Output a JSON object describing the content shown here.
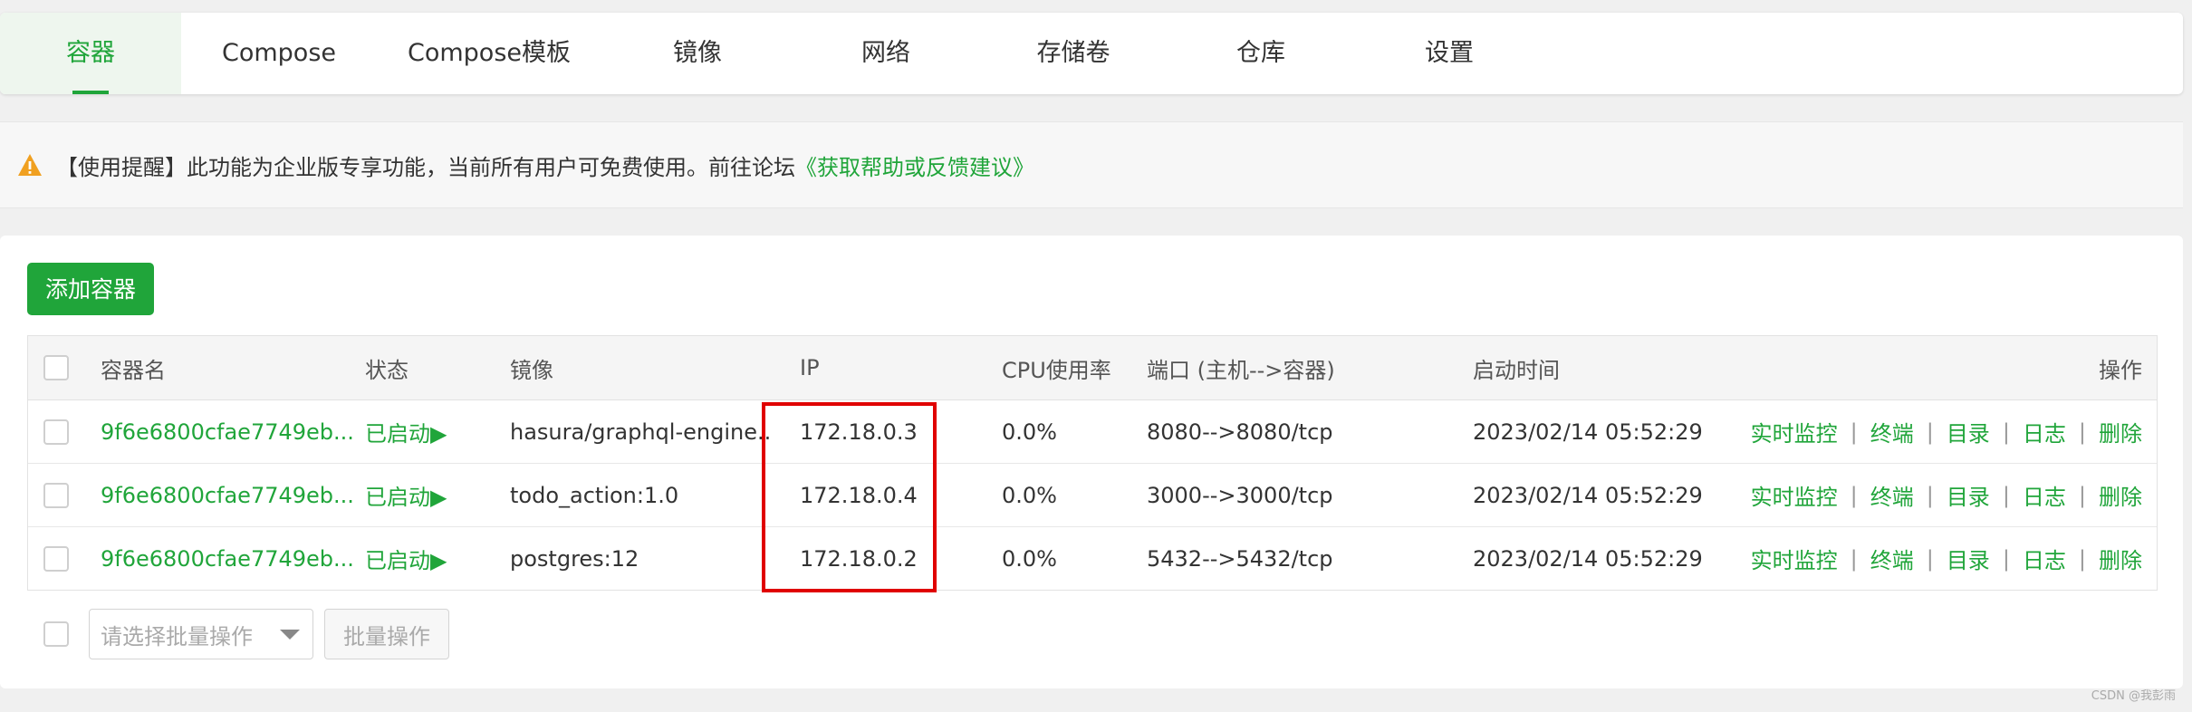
{
  "tabs": [
    {
      "label": "容器",
      "active": true
    },
    {
      "label": "Compose"
    },
    {
      "label": "Compose模板"
    },
    {
      "label": "镜像"
    },
    {
      "label": "网络"
    },
    {
      "label": "存储卷"
    },
    {
      "label": "仓库"
    },
    {
      "label": "设置"
    }
  ],
  "notice": {
    "icon": "warning-icon",
    "text": "【使用提醒】此功能为企业版专享功能，当前所有用户可免费使用。前往论坛",
    "link": "《获取帮助或反馈建议》"
  },
  "toolbar": {
    "add_label": "添加容器"
  },
  "table": {
    "headers": {
      "name": "容器名",
      "status": "状态",
      "image": "镜像",
      "ip": "IP",
      "cpu": "CPU使用率",
      "ports": "端口 (主机-->容器)",
      "started": "启动时间",
      "ops": "操作"
    },
    "rows": [
      {
        "name": "9f6e6800cfae7749eb...",
        "status": "已启动▶",
        "image": "hasura/graphql-engine...",
        "ip": "172.18.0.3",
        "cpu": "0.0%",
        "ports": "8080-->8080/tcp",
        "started": "2023/02/14 05:52:29"
      },
      {
        "name": "9f6e6800cfae7749eb...",
        "status": "已启动▶",
        "image": "todo_action:1.0",
        "ip": "172.18.0.4",
        "cpu": "0.0%",
        "ports": "3000-->3000/tcp",
        "started": "2023/02/14 05:52:29"
      },
      {
        "name": "9f6e6800cfae7749eb...",
        "status": "已启动▶",
        "image": "postgres:12",
        "ip": "172.18.0.2",
        "cpu": "0.0%",
        "ports": "5432-->5432/tcp",
        "started": "2023/02/14 05:52:29"
      }
    ],
    "ops": [
      "实时监控",
      "终端",
      "目录",
      "日志",
      "删除"
    ],
    "op_separator": "|"
  },
  "batch": {
    "select_placeholder": "请选择批量操作",
    "button_label": "批量操作"
  },
  "watermark": "CSDN @我彭雨",
  "colors": {
    "accent": "#20a53a",
    "highlight": "#e00000",
    "warning": "#f0a020"
  }
}
